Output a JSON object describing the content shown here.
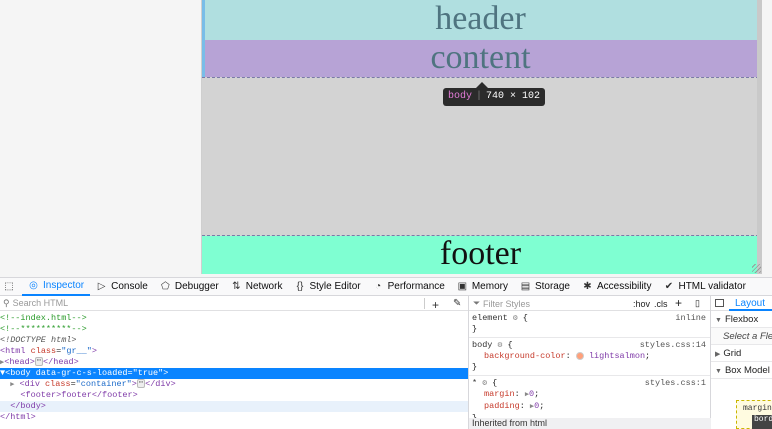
{
  "page": {
    "header_text": "header",
    "content_text": "content",
    "footer_text": "footer"
  },
  "tooltip": {
    "tag": "body",
    "size": "740 × 102"
  },
  "devtools": {
    "tabs": [
      {
        "label": "Inspector",
        "icon": "inspector-icon"
      },
      {
        "label": "Console",
        "icon": "console-icon"
      },
      {
        "label": "Debugger",
        "icon": "debugger-icon"
      },
      {
        "label": "Network",
        "icon": "network-icon"
      },
      {
        "label": "Style Editor",
        "icon": "style-editor-icon"
      },
      {
        "label": "Performance",
        "icon": "performance-icon"
      },
      {
        "label": "Memory",
        "icon": "memory-icon"
      },
      {
        "label": "Storage",
        "icon": "storage-icon"
      },
      {
        "label": "Accessibility",
        "icon": "accessibility-icon"
      },
      {
        "label": "HTML validator",
        "icon": "html-validator-icon"
      }
    ],
    "search_placeholder": "Search HTML",
    "tree": {
      "comment1": "<!--index.html-->",
      "comment2": "<!--**********-->",
      "doctype": "<!DOCTYPE html>",
      "html_open_tag": "<html",
      "html_attr": "class",
      "html_val": "\"gr__\"",
      "head": "<head>",
      "head_close": "</head>",
      "body_open": "<body data-gr-c-s-loaded=\"true\">",
      "div_open": "<div",
      "div_attr": "class",
      "div_val": "\"container\"",
      "div_close": "</div>",
      "footer_line": "<footer>footer</footer>",
      "body_close": "</body>",
      "html_close": "</html>",
      "ellipsis": "⋯"
    },
    "rules": {
      "filter_placeholder": "Filter Styles",
      "hov": ":hov",
      "cls": ".cls",
      "element_selector": "element",
      "element_source": "inline",
      "body_selector": "body",
      "body_source": "styles.css:14",
      "body_prop": "background-color",
      "body_value": "lightsalmon",
      "star_selector": "*",
      "star_source": "styles.css:1",
      "margin_prop": "margin",
      "margin_value": "0",
      "padding_prop": "padding",
      "padding_value": "0",
      "inherited": "Inherited from html"
    },
    "layout": {
      "tab_label": "Layout",
      "flexbox": "Flexbox",
      "select_flex": "Select a Flex",
      "grid": "Grid",
      "box_model": "Box Model",
      "margin_label": "margin",
      "border_label": "bord"
    }
  },
  "colors": {
    "header_bg": "#b0dfe0",
    "content_bg": "#b7a3d6",
    "footer_bg": "#7fffd2",
    "body_bg": "#d3d3d3",
    "accent": "#0a84ff",
    "swatch": "#ffa07a"
  }
}
